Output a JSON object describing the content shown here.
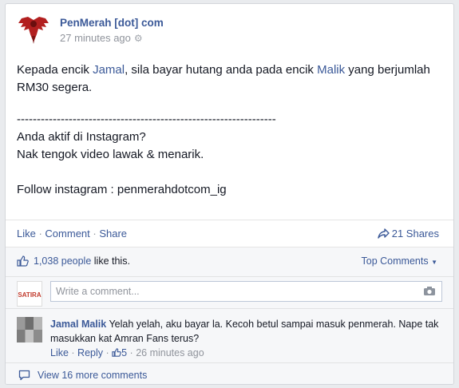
{
  "post": {
    "page_name": "PenMerah [dot] com",
    "timestamp": "27 minutes ago",
    "line1_a": "Kepada encik ",
    "mention1": "Jamal",
    "line1_b": ", sila bayar hutang anda pada encik ",
    "mention2": "Malik",
    "line1_c": " yang berjumlah RM30 segera.",
    "divider": "-----------------------------------------------------------------",
    "line2": "Anda aktif di Instagram?",
    "line3": "Nak tengok video lawak & menarik.",
    "line4": "Follow instagram : penmerahdotcom_ig"
  },
  "actions": {
    "like": "Like",
    "comment": "Comment",
    "share": "Share",
    "shares_count": "21 Shares"
  },
  "feedback": {
    "likes_count": "1,038 people",
    "likes_suffix": "like this.",
    "top_comments": "Top Comments",
    "comment_placeholder": "Write a comment...",
    "my_avatar_label": "SATIRA"
  },
  "comment": {
    "first_name": "Jamal",
    "last_name": "Malik",
    "text": "Yelah yelah, aku bayar la. Kecoh betul sampai masuk penmerah. Nape tak masukkan kat Amran Fans terus?",
    "like": "Like",
    "reply": "Reply",
    "likes": "5",
    "time": "26 minutes ago"
  },
  "view_more": "View 16 more comments",
  "colors": {
    "link": "#3b5998",
    "muted": "#90949c",
    "text": "#141823"
  }
}
